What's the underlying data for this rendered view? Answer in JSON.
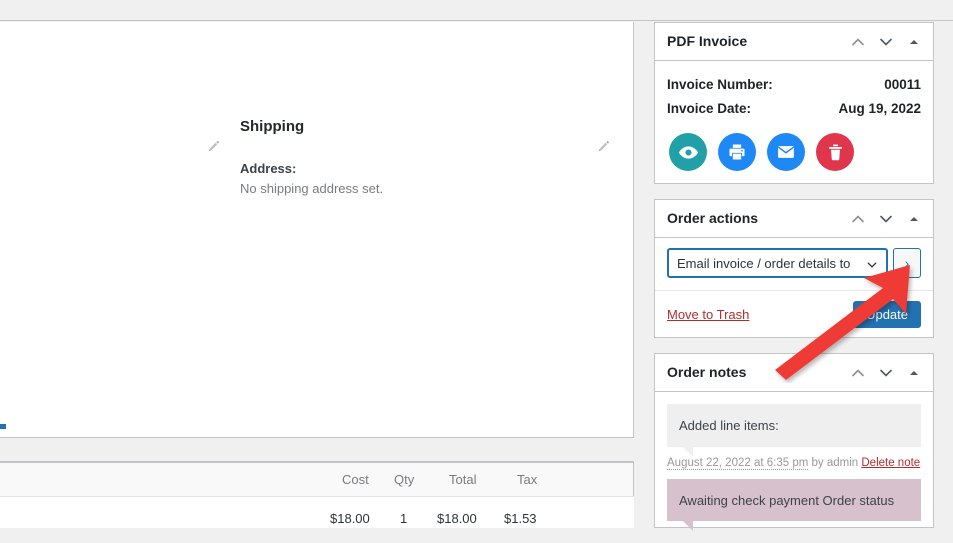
{
  "left": {
    "shipping": {
      "heading": "Shipping",
      "address_label": "Address:",
      "address_value": "No shipping address set.",
      "edit_icon": "pencil-icon"
    },
    "items_table": {
      "columns": [
        "Cost",
        "Qty",
        "Total",
        "Tax"
      ],
      "row": [
        "$18.00",
        "1",
        "$18.00",
        "$1.53"
      ]
    }
  },
  "pdf_invoice": {
    "title": "PDF Invoice",
    "rows": [
      {
        "label": "Invoice Number:",
        "value": "00011"
      },
      {
        "label": "Invoice Date:",
        "value": "Aug 19, 2022"
      }
    ],
    "actions": [
      {
        "name": "view-invoice-button",
        "icon": "eye-icon",
        "color": "#22a0a8"
      },
      {
        "name": "print-invoice-button",
        "icon": "printer-icon",
        "color": "#1e88f5"
      },
      {
        "name": "email-invoice-button",
        "icon": "envelope-icon",
        "color": "#1e88f5"
      },
      {
        "name": "delete-invoice-button",
        "icon": "trash-icon",
        "color": "#e0364c"
      }
    ]
  },
  "order_actions": {
    "title": "Order actions",
    "select_value": "Email invoice / order details to",
    "go_label": "›",
    "trash_label": "Move to Trash",
    "update_label": "Update"
  },
  "order_notes": {
    "title": "Order notes",
    "notes": [
      {
        "text": "Added line items:",
        "date": "August 22, 2022 at 6:35 pm",
        "by": "by admin",
        "delete_label": "Delete note",
        "system": false
      },
      {
        "text": "Awaiting check payment Order status",
        "system": true
      }
    ]
  },
  "panel_controls": {
    "move_up": "move-up-icon",
    "move_down": "move-down-icon",
    "toggle": "toggle-panel-icon"
  },
  "colors": {
    "accent": "#2271b1",
    "danger": "#b32d2e",
    "teal": "#22a0a8",
    "note_system_bg": "#d7c1cd",
    "annotation_arrow": "#ef3b36"
  }
}
